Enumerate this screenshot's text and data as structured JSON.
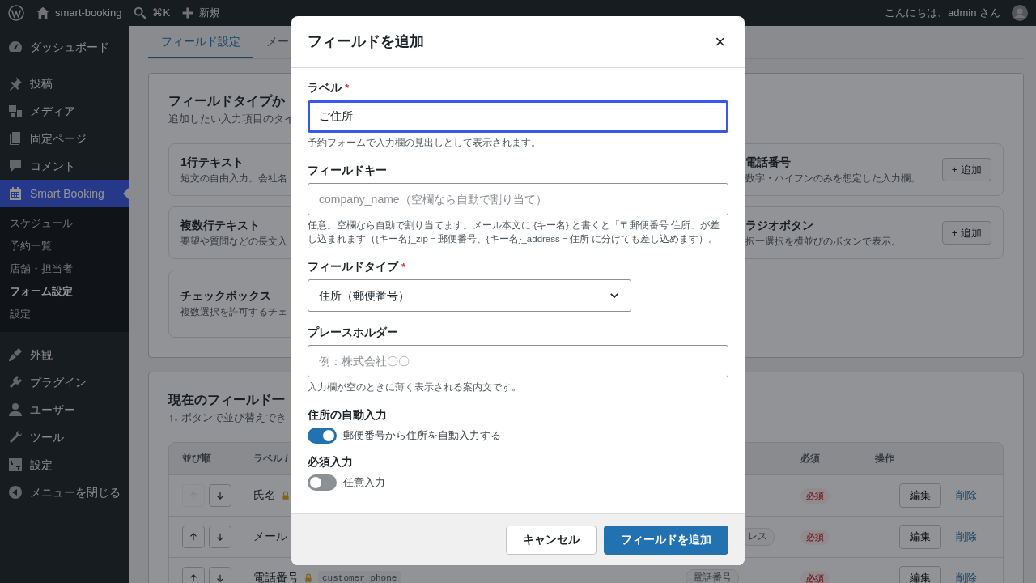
{
  "admin_bar": {
    "site": "smart-booking",
    "search_shortcut": "⌘K",
    "new": "新規",
    "greeting": "こんにちは、admin さん"
  },
  "sidebar": {
    "groups": [
      {
        "items": [
          {
            "label": "ダッシュボード",
            "selected": false
          }
        ]
      },
      {
        "items": [
          {
            "label": "投稿",
            "selected": false
          },
          {
            "label": "メディア",
            "selected": false
          },
          {
            "label": "固定ページ",
            "selected": false
          },
          {
            "label": "コメント",
            "selected": false
          },
          {
            "label": "Smart Booking",
            "selected": true,
            "children": [
              {
                "label": "スケジュール",
                "selected": false
              },
              {
                "label": "予約一覧",
                "selected": false
              },
              {
                "label": "店舗・担当者",
                "selected": false
              },
              {
                "label": "フォーム設定",
                "selected": true
              },
              {
                "label": "設定",
                "selected": false
              }
            ]
          }
        ]
      },
      {
        "items": [
          {
            "label": "外観",
            "selected": false
          },
          {
            "label": "プラグイン",
            "selected": false
          },
          {
            "label": "ユーザー",
            "selected": false
          },
          {
            "label": "ツール",
            "selected": false
          },
          {
            "label": "設定",
            "selected": false
          },
          {
            "label": "メニューを閉じる",
            "selected": false
          }
        ]
      }
    ]
  },
  "tabs": [
    {
      "label": "フィールド設定",
      "selected": true
    },
    {
      "label": "メー",
      "selected": false
    }
  ],
  "type_panel": {
    "title": "フィールドタイプか",
    "subtitle": "追加したい入力項目のタイ",
    "left": [
      {
        "name": "1行テキスト",
        "description": "短文の自由入力。会社名"
      },
      {
        "name": "複数行テキスト",
        "description": "要望や質問などの長文入"
      },
      {
        "name": "チェックボックス",
        "description": "複数選択を許可するチェ"
      }
    ],
    "right": [
      {
        "name": "電話番号",
        "description": "数字・ハイフンのみを想定した入力欄。",
        "button": "+ 追加"
      },
      {
        "name": "ラジオボタン",
        "description": "択一選択を横並びのボタンで表示。",
        "button": "+ 追加"
      }
    ]
  },
  "field_list": {
    "title": "現在のフィールド一",
    "subtitle": "↑↓ ボタンで並び替えでき",
    "columns": [
      "並び順",
      "ラベル /",
      "必須",
      "操作"
    ],
    "rows": [
      {
        "label": "氏名",
        "locked": true,
        "up_disabled": true,
        "required": "必須",
        "edit": "編集",
        "delete": "削除"
      },
      {
        "label": "メール",
        "up_disabled": false,
        "type": "レス",
        "required": "必須",
        "edit": "編集",
        "delete": "削除"
      },
      {
        "label": "電話番号",
        "locked": true,
        "key": "customer_phone",
        "up_disabled": false,
        "type": "電話番号",
        "required": "必須",
        "edit": "編集",
        "delete": "削除"
      }
    ]
  },
  "modal": {
    "title": "フィールドを追加",
    "close": "×",
    "required_mark": "*",
    "fields": [
      {
        "kind": "text",
        "label": "ラベル",
        "required": true,
        "value": "ご住所",
        "focused": true,
        "help": "予約フォームで入力欄の見出しとして表示されます。"
      },
      {
        "kind": "text",
        "label": "フィールドキー",
        "required": false,
        "placeholder": "company_name（空欄なら自動で割り当て）",
        "focused": false,
        "help": "任意。空欄なら自動で割り当てます。メール本文に {キー名} と書くと「〒郵便番号 住所」が差し込まれます（{キー名}_zip＝郵便番号、{キー名}_address＝住所 に分けても差し込めます）。"
      },
      {
        "kind": "select",
        "label": "フィールドタイプ",
        "required": true,
        "value": "住所（郵便番号）"
      },
      {
        "kind": "text",
        "label": "プレースホルダー",
        "required": false,
        "placeholder": "例：株式会社〇〇",
        "focused": false,
        "help": "入力欄が空のときに薄く表示される案内文です。"
      },
      {
        "kind": "toggle",
        "label": "住所の自動入力",
        "on": true,
        "text": "郵便番号から住所を自動入力する"
      },
      {
        "kind": "toggle",
        "label": "必須入力",
        "on": false,
        "text": "任意入力"
      }
    ],
    "buttons": [
      {
        "label": "キャンセル",
        "primary": false
      },
      {
        "label": "フィールドを追加",
        "primary": true
      }
    ]
  }
}
